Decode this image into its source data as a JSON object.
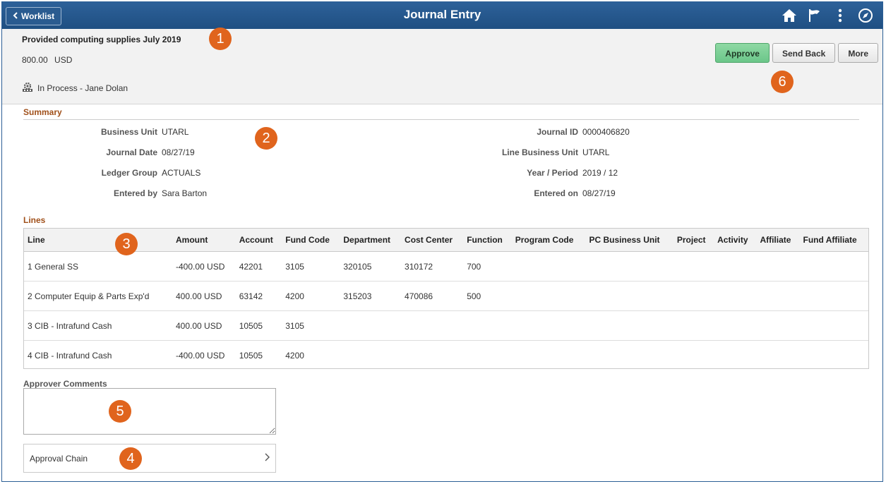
{
  "topbar": {
    "back_label": "Worklist",
    "title": "Journal Entry",
    "icons": [
      "home-icon",
      "flag-icon",
      "more-vertical-icon",
      "compass-icon"
    ]
  },
  "header": {
    "description": "Provided computing supplies July 2019",
    "amount": "800.00",
    "currency": "USD",
    "status": "In Process - ",
    "status_user": "Jane Dolan",
    "actions": {
      "approve": "Approve",
      "send_back": "Send Back",
      "more": "More"
    }
  },
  "callouts": [
    "1",
    "2",
    "3",
    "4",
    "5",
    "6"
  ],
  "summary": {
    "title": "Summary",
    "left": [
      {
        "label": "Business Unit",
        "value": "UTARL"
      },
      {
        "label": "Journal Date",
        "value": "08/27/19"
      },
      {
        "label": "Ledger Group",
        "value": "ACTUALS"
      },
      {
        "label": "Entered by",
        "value": "Sara Barton"
      }
    ],
    "right": [
      {
        "label": "Journal ID",
        "value": "0000406820"
      },
      {
        "label": "Line Business Unit",
        "value": "UTARL"
      },
      {
        "label": "Year / Period",
        "value": "2019 / 12"
      },
      {
        "label": "Entered on",
        "value": "08/27/19"
      }
    ]
  },
  "lines": {
    "title": "Lines",
    "columns": [
      "Line",
      "Amount",
      "Account",
      "Fund Code",
      "Department",
      "Cost Center",
      "Function",
      "Program Code",
      "PC Business Unit",
      "Project",
      "Activity",
      "Affiliate",
      "Fund Affiliate"
    ],
    "rows": [
      [
        "1 General SS",
        "-400.00 USD",
        "42201",
        "3105",
        "320105",
        "310172",
        "700",
        "",
        "",
        "",
        "",
        "",
        ""
      ],
      [
        "2 Computer Equip & Parts Exp'd",
        "400.00 USD",
        "63142",
        "4200",
        "315203",
        "470086",
        "500",
        "",
        "",
        "",
        "",
        "",
        ""
      ],
      [
        "3 CIB - Intrafund Cash",
        "400.00 USD",
        "10505",
        "3105",
        "",
        "",
        "",
        "",
        "",
        "",
        "",
        "",
        ""
      ],
      [
        "4 CIB - Intrafund Cash",
        "-400.00 USD",
        "10505",
        "4200",
        "",
        "",
        "",
        "",
        "",
        "",
        "",
        "",
        ""
      ]
    ]
  },
  "comments": {
    "label": "Approver Comments",
    "value": ""
  },
  "approval_chain": {
    "label": "Approval Chain"
  },
  "colors": {
    "topbar": "#2d6199",
    "approve": "#6bc689",
    "section": "#a0501a",
    "callout": "#e0641d"
  }
}
